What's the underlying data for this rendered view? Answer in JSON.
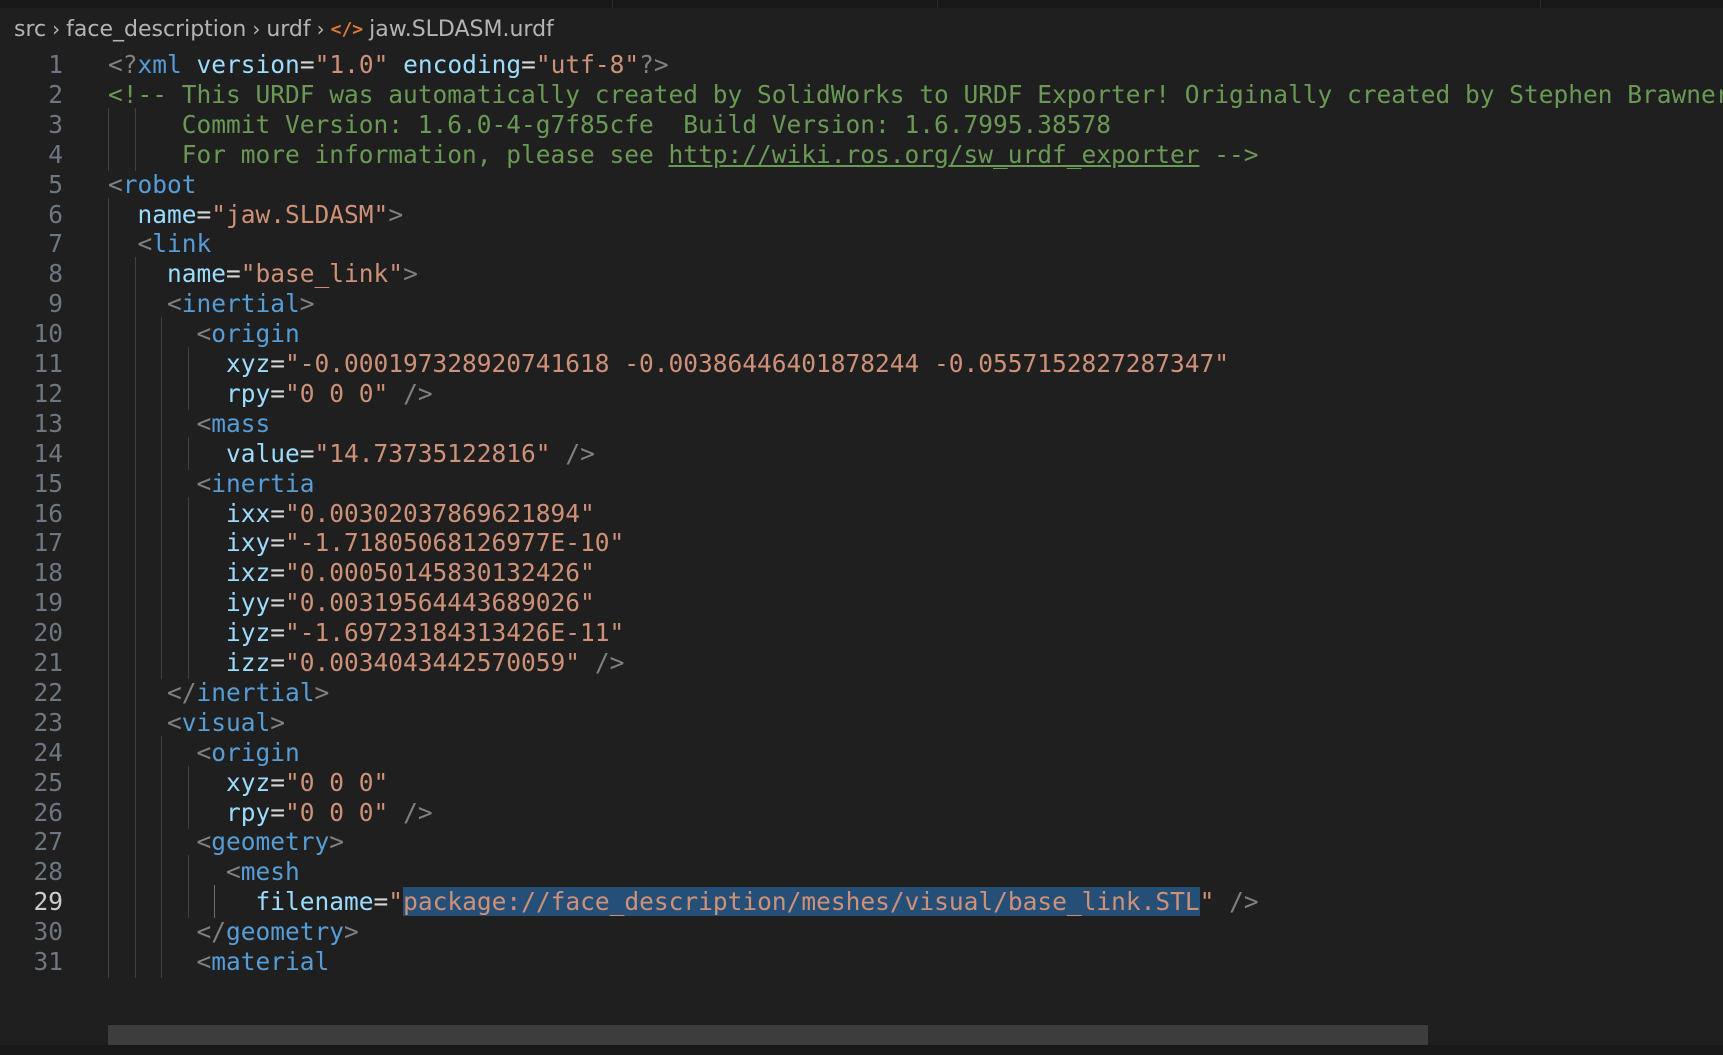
{
  "breadcrumb": {
    "items": [
      "src",
      "face_description",
      "urdf"
    ],
    "file_icon": "</>",
    "file": "jaw.SLDASM.urdf"
  },
  "editor": {
    "active_line": 29,
    "selection_text": "package://face_description/meshes/visual/base_link.STL",
    "lines": [
      {
        "n": "1",
        "indent": 0,
        "tokens": [
          [
            "p",
            "<?"
          ],
          [
            "tg",
            "xml"
          ],
          [
            "tx",
            " "
          ],
          [
            "at",
            "version"
          ],
          [
            "tx",
            "="
          ],
          [
            "sv",
            "\"1.0\""
          ],
          [
            "tx",
            " "
          ],
          [
            "at",
            "encoding"
          ],
          [
            "tx",
            "="
          ],
          [
            "sv",
            "\"utf-8\""
          ],
          [
            "p",
            "?>"
          ]
        ]
      },
      {
        "n": "2",
        "indent": 0,
        "tokens": [
          [
            "cm",
            "<!-- This URDF was automatically created by SolidWorks to URDF Exporter! Originally created by Stephen Brawner"
          ]
        ]
      },
      {
        "n": "3",
        "indent": 2,
        "tokens": [
          [
            "cm",
            "     Commit Version: 1.6.0-4-g7f85cfe  Build Version: 1.6.7995.38578"
          ]
        ]
      },
      {
        "n": "4",
        "indent": 2,
        "tokens": [
          [
            "cm",
            "     For more information, please see "
          ],
          [
            "cml",
            "http://wiki.ros.org/sw_urdf_exporter"
          ],
          [
            "cm",
            " -->"
          ]
        ]
      },
      {
        "n": "5",
        "indent": 0,
        "tokens": [
          [
            "p",
            "<"
          ],
          [
            "tg",
            "robot"
          ]
        ]
      },
      {
        "n": "6",
        "indent": 1,
        "tokens": [
          [
            "tx",
            "  "
          ],
          [
            "at",
            "name"
          ],
          [
            "tx",
            "="
          ],
          [
            "sv",
            "\"jaw.SLDASM\""
          ],
          [
            "p",
            ">"
          ]
        ]
      },
      {
        "n": "7",
        "indent": 1,
        "tokens": [
          [
            "tx",
            "  "
          ],
          [
            "p",
            "<"
          ],
          [
            "tg",
            "link"
          ]
        ]
      },
      {
        "n": "8",
        "indent": 2,
        "tokens": [
          [
            "tx",
            "    "
          ],
          [
            "at",
            "name"
          ],
          [
            "tx",
            "="
          ],
          [
            "sv",
            "\"base_link\""
          ],
          [
            "p",
            ">"
          ]
        ]
      },
      {
        "n": "9",
        "indent": 2,
        "tokens": [
          [
            "tx",
            "    "
          ],
          [
            "p",
            "<"
          ],
          [
            "tg",
            "inertial"
          ],
          [
            "p",
            ">"
          ]
        ]
      },
      {
        "n": "10",
        "indent": 3,
        "tokens": [
          [
            "tx",
            "      "
          ],
          [
            "p",
            "<"
          ],
          [
            "tg",
            "origin"
          ]
        ]
      },
      {
        "n": "11",
        "indent": 4,
        "tokens": [
          [
            "tx",
            "        "
          ],
          [
            "at",
            "xyz"
          ],
          [
            "tx",
            "="
          ],
          [
            "sv",
            "\"-0.000197328920741618 -0.00386446401878244 -0.0557152827287347\""
          ]
        ]
      },
      {
        "n": "12",
        "indent": 4,
        "tokens": [
          [
            "tx",
            "        "
          ],
          [
            "at",
            "rpy"
          ],
          [
            "tx",
            "="
          ],
          [
            "sv",
            "\"0 0 0\""
          ],
          [
            "tx",
            " "
          ],
          [
            "p",
            "/>"
          ]
        ]
      },
      {
        "n": "13",
        "indent": 3,
        "tokens": [
          [
            "tx",
            "      "
          ],
          [
            "p",
            "<"
          ],
          [
            "tg",
            "mass"
          ]
        ]
      },
      {
        "n": "14",
        "indent": 4,
        "tokens": [
          [
            "tx",
            "        "
          ],
          [
            "at",
            "value"
          ],
          [
            "tx",
            "="
          ],
          [
            "sv",
            "\"14.73735122816\""
          ],
          [
            "tx",
            " "
          ],
          [
            "p",
            "/>"
          ]
        ]
      },
      {
        "n": "15",
        "indent": 3,
        "tokens": [
          [
            "tx",
            "      "
          ],
          [
            "p",
            "<"
          ],
          [
            "tg",
            "inertia"
          ]
        ]
      },
      {
        "n": "16",
        "indent": 4,
        "tokens": [
          [
            "tx",
            "        "
          ],
          [
            "at",
            "ixx"
          ],
          [
            "tx",
            "="
          ],
          [
            "sv",
            "\"0.00302037869621894\""
          ]
        ]
      },
      {
        "n": "17",
        "indent": 4,
        "tokens": [
          [
            "tx",
            "        "
          ],
          [
            "at",
            "ixy"
          ],
          [
            "tx",
            "="
          ],
          [
            "sv",
            "\"-1.71805068126977E-10\""
          ]
        ]
      },
      {
        "n": "18",
        "indent": 4,
        "tokens": [
          [
            "tx",
            "        "
          ],
          [
            "at",
            "ixz"
          ],
          [
            "tx",
            "="
          ],
          [
            "sv",
            "\"0.00050145830132426\""
          ]
        ]
      },
      {
        "n": "19",
        "indent": 4,
        "tokens": [
          [
            "tx",
            "        "
          ],
          [
            "at",
            "iyy"
          ],
          [
            "tx",
            "="
          ],
          [
            "sv",
            "\"0.00319564443689026\""
          ]
        ]
      },
      {
        "n": "20",
        "indent": 4,
        "tokens": [
          [
            "tx",
            "        "
          ],
          [
            "at",
            "iyz"
          ],
          [
            "tx",
            "="
          ],
          [
            "sv",
            "\"-1.69723184313426E-11\""
          ]
        ]
      },
      {
        "n": "21",
        "indent": 4,
        "tokens": [
          [
            "tx",
            "        "
          ],
          [
            "at",
            "izz"
          ],
          [
            "tx",
            "="
          ],
          [
            "sv",
            "\"0.0034043442570059\""
          ],
          [
            "tx",
            " "
          ],
          [
            "p",
            "/>"
          ]
        ]
      },
      {
        "n": "22",
        "indent": 2,
        "tokens": [
          [
            "tx",
            "    "
          ],
          [
            "p",
            "</"
          ],
          [
            "tg",
            "inertial"
          ],
          [
            "p",
            ">"
          ]
        ]
      },
      {
        "n": "23",
        "indent": 2,
        "tokens": [
          [
            "tx",
            "    "
          ],
          [
            "p",
            "<"
          ],
          [
            "tg",
            "visual"
          ],
          [
            "p",
            ">"
          ]
        ]
      },
      {
        "n": "24",
        "indent": 3,
        "tokens": [
          [
            "tx",
            "      "
          ],
          [
            "p",
            "<"
          ],
          [
            "tg",
            "origin"
          ]
        ]
      },
      {
        "n": "25",
        "indent": 4,
        "tokens": [
          [
            "tx",
            "        "
          ],
          [
            "at",
            "xyz"
          ],
          [
            "tx",
            "="
          ],
          [
            "sv",
            "\"0 0 0\""
          ]
        ]
      },
      {
        "n": "26",
        "indent": 4,
        "tokens": [
          [
            "tx",
            "        "
          ],
          [
            "at",
            "rpy"
          ],
          [
            "tx",
            "="
          ],
          [
            "sv",
            "\"0 0 0\""
          ],
          [
            "tx",
            " "
          ],
          [
            "p",
            "/>"
          ]
        ]
      },
      {
        "n": "27",
        "indent": 3,
        "tokens": [
          [
            "tx",
            "      "
          ],
          [
            "p",
            "<"
          ],
          [
            "tg",
            "geometry"
          ],
          [
            "p",
            ">"
          ]
        ]
      },
      {
        "n": "28",
        "indent": 4,
        "tokens": [
          [
            "tx",
            "        "
          ],
          [
            "p",
            "<"
          ],
          [
            "tg",
            "mesh"
          ]
        ]
      },
      {
        "n": "29",
        "indent": 5,
        "tokens": [
          [
            "tx",
            "          "
          ],
          [
            "at",
            "filename"
          ],
          [
            "tx",
            "="
          ],
          [
            "sv",
            "\""
          ],
          [
            "sel",
            "package://face_description/meshes/visual/base_link.STL"
          ],
          [
            "sv",
            "\""
          ],
          [
            "tx",
            " "
          ],
          [
            "p",
            "/>"
          ]
        ]
      },
      {
        "n": "30",
        "indent": 3,
        "tokens": [
          [
            "tx",
            "      "
          ],
          [
            "p",
            "</"
          ],
          [
            "tg",
            "geometry"
          ],
          [
            "p",
            ">"
          ]
        ]
      },
      {
        "n": "31",
        "indent": 3,
        "tokens": [
          [
            "tx",
            "      "
          ],
          [
            "p",
            "<"
          ],
          [
            "tg",
            "material"
          ]
        ]
      }
    ]
  }
}
